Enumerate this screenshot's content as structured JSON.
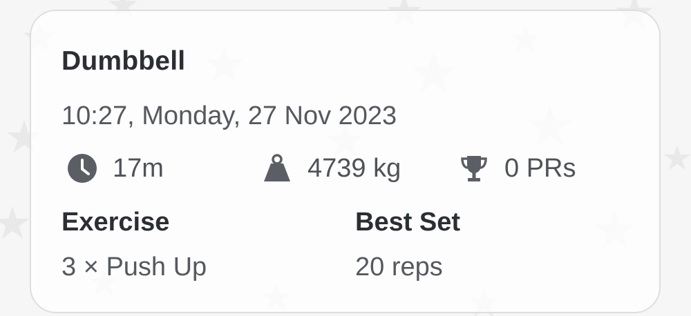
{
  "workout": {
    "title": "Dumbbell",
    "datetime": "10:27, Monday, 27 Nov 2023"
  },
  "stats": {
    "duration": "17m",
    "volume": "4739 kg",
    "prs": "0 PRs"
  },
  "table": {
    "exercise_header": "Exercise",
    "best_set_header": "Best Set",
    "exercise_value": "3 × Push Up",
    "best_set_value": "20 reps"
  },
  "icons": {
    "duration": "clock-icon",
    "volume": "weight-icon",
    "prs": "trophy-icon"
  },
  "colors": {
    "icon": "#5b5f65",
    "title": "#2b2e33",
    "text": "#55595f",
    "border": "#dedede"
  }
}
